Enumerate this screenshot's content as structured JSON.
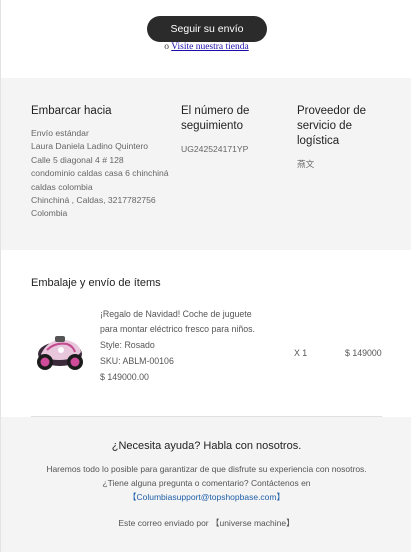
{
  "top": {
    "track_button": "Seguir su envío",
    "or_text": "o",
    "store_link": "Visite nuestra tienda"
  },
  "shipping": {
    "ship_to_title": "Embarcar hacia",
    "ship_to_lines": [
      "Envío estándar",
      "Laura Daniela Ladino Quintero",
      "Calle 5 diagonal 4 # 128",
      "condominio caldas casa 6 chinchiná",
      "caldas colombia",
      "Chinchiná , Caldas, 3217782756",
      "Colombia"
    ],
    "tracking_title": "El número de seguimiento",
    "tracking_number": "UG242524171YP",
    "carrier_title": "Proveedor de servicio de logística",
    "carrier_name": "燕文"
  },
  "items": {
    "title": "Embalaje y envío de ítems",
    "list": [
      {
        "name": "¡Regalo de Navidad! Coche de juguete para montar eléctrico fresco para niños.",
        "style": "Style: Rosado",
        "sku": "SKU: ABLM-00106",
        "unit_price": "$ 149000.00",
        "qty": "X 1",
        "total": "$ 149000",
        "image_icon": "pink-ride-on-toy-car"
      }
    ]
  },
  "help": {
    "title": "¿Necesita ayuda? Habla con nosotros.",
    "message": "Haremos todo lo posible para garantizar de que disfrute su experiencia con nosotros.¿Tiene alguna pregunta o comentario? Contáctenos en",
    "email": "【Columbiasupport@topshopbase.com】",
    "sent_by": "Este correo enviado por 【universe machine】"
  },
  "colors": {
    "button_bg": "#2b2b2b",
    "section_bg": "#f4f4f4",
    "link": "#1a0dab",
    "email_link": "#1f5fa8"
  }
}
